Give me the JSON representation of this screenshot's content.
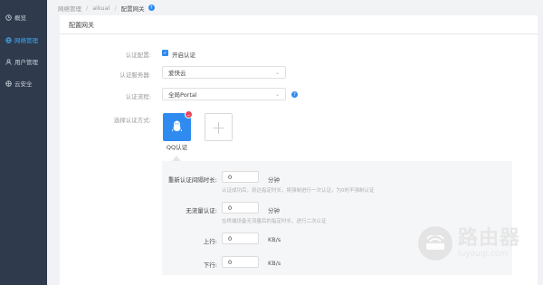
{
  "sidebar": {
    "items": [
      {
        "label": "概览",
        "icon": "clock-icon",
        "active": false
      },
      {
        "label": "网络管理",
        "icon": "network-icon",
        "active": true
      },
      {
        "label": "用户管理",
        "icon": "user-icon",
        "active": false
      },
      {
        "label": "云安全",
        "icon": "globe-icon",
        "active": false
      }
    ]
  },
  "breadcrumb": {
    "items": [
      "网络管理",
      "aikual",
      "配置网关"
    ],
    "separator": "/",
    "help_icon": "question-icon"
  },
  "page": {
    "title": "配置网关"
  },
  "form": {
    "auth_config": {
      "label": "认证配置:",
      "checkbox_label": "开启认证",
      "checked": true
    },
    "auth_server": {
      "label": "认证服务器:",
      "value": "爱快云"
    },
    "auth_flow": {
      "label": "认证流程:",
      "value": "全局Portal"
    },
    "auth_method": {
      "label": "选择认证方式:",
      "selected": "QQ认证",
      "add_icon": "plus-icon"
    }
  },
  "panel": {
    "reauth": {
      "label": "重新认证间隔时长:",
      "value": "0",
      "unit": "分钟",
      "hint": "认证成功后，到达指定时长，将强制进行一次认证，为0时不强制认证"
    },
    "idle": {
      "label": "无流量认证:",
      "value": "0",
      "unit": "分钟",
      "hint": "在终端设备无流量后的指定时长，进行二次认证"
    },
    "upload": {
      "label": "上行:",
      "value": "0",
      "unit": "KB/s"
    },
    "download": {
      "label": "下行:",
      "value": "0",
      "unit": "KB/s"
    }
  },
  "watermark": {
    "cn": "路由器",
    "url": "luyouqi.com"
  },
  "colors": {
    "accent": "#2f8bf0",
    "sidebar_bg": "#2f3a4c",
    "delete_badge": "#e9445a"
  }
}
